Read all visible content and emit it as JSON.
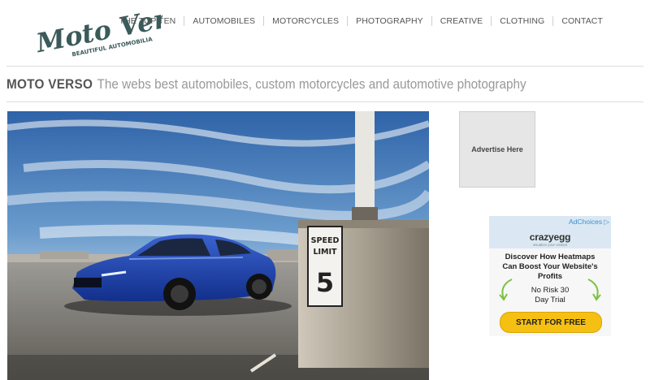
{
  "logo": {
    "alt": "Moto Verso - Beautiful Automobilia"
  },
  "nav": {
    "items": [
      "THE TOP TEN",
      "AUTOMOBILES",
      "MOTORCYCLES",
      "PHOTOGRAPHY",
      "CREATIVE",
      "CLOTHING",
      "CONTACT"
    ]
  },
  "tagline": {
    "brand": "MOTO VERSO",
    "text": "The webs best automobiles, custom motorcycles and automotive photography"
  },
  "hero": {
    "sign_line1": "SPEED",
    "sign_line2": "LIMIT",
    "sign_number": "5"
  },
  "ad_box": {
    "label": "Advertise Here"
  },
  "banner": {
    "adchoices": "AdChoices",
    "brand": "crazyegg",
    "brand_sub": "visualize your visitors",
    "headline": "Discover How Heatmaps\nCan Boost Your Website's\nProfits",
    "offer": "No Risk 30\nDay Trial",
    "cta": "START FOR FREE"
  },
  "colors": {
    "accent_yellow": "#f6c012",
    "nav_text": "#555555",
    "tagline_gray": "#999999",
    "car_blue": "#1a3fa0"
  }
}
